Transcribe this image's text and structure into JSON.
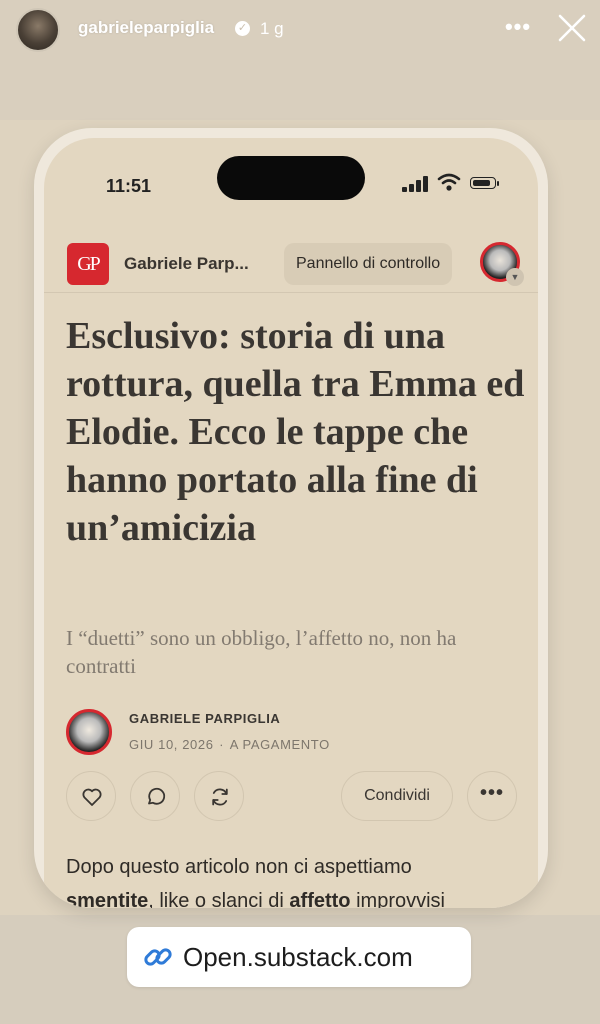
{
  "story": {
    "username": "gabrieleparpiglia",
    "time_ago": "1 g",
    "verified_icon": "verified-badge-icon",
    "more_icon": "more-horizontal-icon",
    "close_icon": "close-icon"
  },
  "phone": {
    "status_time": "11:51",
    "header": {
      "logo_text": "GP",
      "publication_name": "Gabriele Parp...",
      "dashboard_label": "Pannello di controllo"
    },
    "article": {
      "title": "Esclusivo: storia di una rottura, quella tra Emma ed Elodie. Ecco le tappe che hanno portato alla fine di un’amicizia",
      "subtitle": "I “duetti” sono un obbligo, l’affetto no, non ha contratti",
      "author": "GABRIELE PARPIGLIA",
      "date": "GIU 10, 2026",
      "separator": "∙",
      "access": "A PAGAMENTO",
      "actions": {
        "like_icon": "heart-icon",
        "comment_icon": "comment-icon",
        "restack_icon": "restack-icon",
        "share_label": "Condividi",
        "more_label": "•••"
      },
      "body": {
        "line1": "Dopo questo articolo non ci aspettiamo",
        "bold1": "smentite",
        "mid": ", like o slanci di ",
        "bold2": "affetto",
        "tail": " improvvisi"
      }
    }
  },
  "link_sticker": {
    "icon": "link-icon",
    "label": "Open.substack.com"
  },
  "colors": {
    "background": "#ded3bf",
    "brand_red": "#d6282f",
    "phone_screen": "#e3d7c1"
  }
}
